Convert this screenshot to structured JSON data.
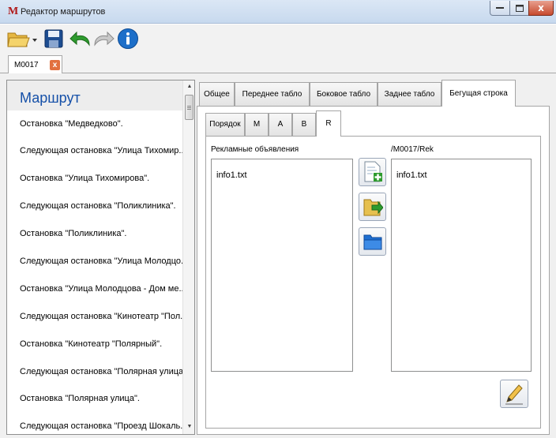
{
  "window": {
    "app_icon": "M",
    "title": "Редактор маршрутов",
    "min_icon": "minimize-icon",
    "max_icon": "maximize-icon",
    "close_glyph": "x"
  },
  "toolbar": {
    "buttons": [
      "open-folder-icon",
      "save-icon",
      "undo-icon",
      "redo-icon",
      "info-icon"
    ]
  },
  "doc_tab": {
    "label": "M0017",
    "close_glyph": "x"
  },
  "route": {
    "header": "Маршрут",
    "items": [
      "Остановка \"Медведково\".",
      "Следующая остановка \"Улица Тихомир...",
      "Остановка \"Улица Тихомирова\".",
      "Следующая остановка \"Поликлиника\".",
      "Остановка \"Поликлиника\".",
      "Следующая остановка \"Улица Молодцо...",
      "Остановка \"Улица Молодцова - Дом ме...",
      "Следующая остановка \"Кинотеатр \"Пол...",
      "Остановка \"Кинотеатр \"Полярный\".",
      "Следующая остановка \"Полярная улица\".",
      "Остановка \"Полярная улица\".",
      "Следующая остановка \"Проезд Шокаль..."
    ],
    "scroll_up_glyph": "▲",
    "scroll_down_glyph": "▼"
  },
  "tabs": {
    "outer": [
      "Общее",
      "Переднее табло",
      "Боковое табло",
      "Заднее табло",
      "Бегущая строка"
    ],
    "outer_active": 4,
    "inner": [
      "Порядок",
      "M",
      "A",
      "B",
      "R"
    ],
    "inner_active": 4
  },
  "ads": {
    "left_label": "Рекламные объявления",
    "right_label": "/M0017/Rek",
    "left_items": [
      "info1.txt"
    ],
    "right_items": [
      "info1.txt"
    ]
  },
  "colors": {
    "header_text": "#1550a8",
    "accent_green": "#2e9b2e",
    "close_red": "#c74a2e"
  }
}
